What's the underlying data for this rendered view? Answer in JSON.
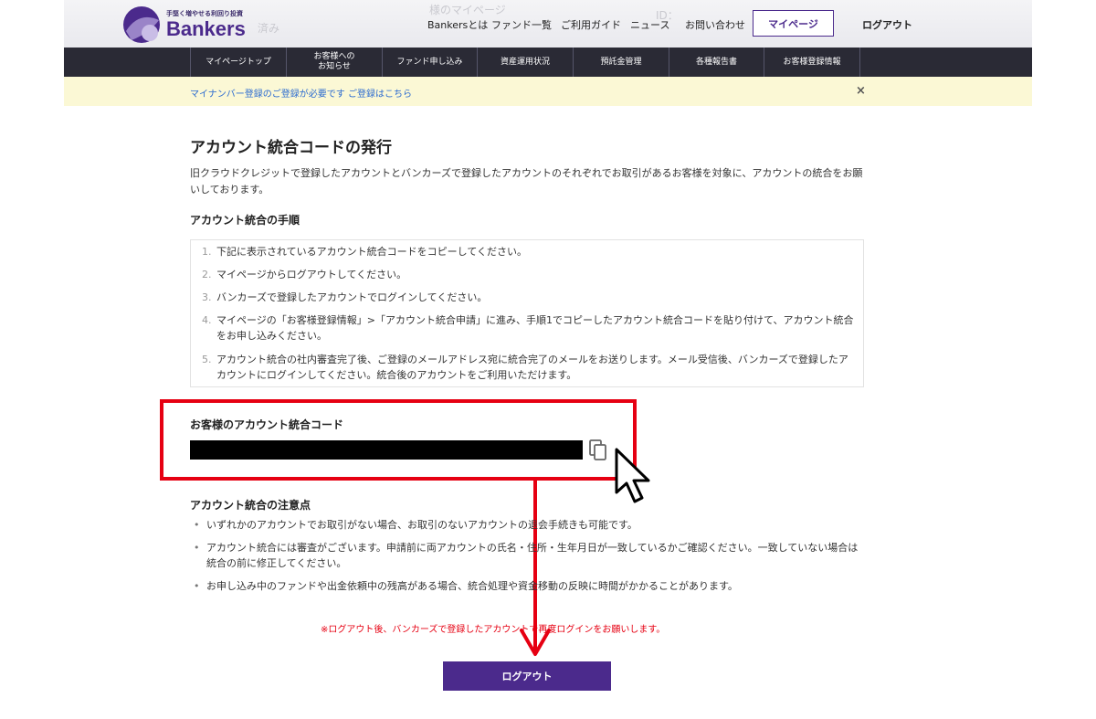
{
  "header": {
    "ghost_texts": [
      "様のマイページ",
      "済み",
      "ID："
    ],
    "logo_tagline": "手堅く増やせる利回り投資",
    "logo_name": "Bankers",
    "nav": [
      "Bankersとは",
      "ファンド一覧",
      "ご利用ガイド",
      "ニュース",
      "お問い合わせ"
    ],
    "mypage_button": "マイページ",
    "logout_link": "ログアウト"
  },
  "subnav": {
    "items": [
      "マイページトップ",
      "お客様への\nお知らせ",
      "ファンド申し込み",
      "資産運用状況",
      "預託金管理",
      "各種報告書",
      "お客様登録情報"
    ]
  },
  "notice": {
    "text": "マイナンバー登録のご登録が必要です ご登録はこちら",
    "close": "×"
  },
  "main": {
    "title": "アカウント統合コードの発行",
    "intro": "旧クラウドクレジットで登録したアカウントとバンカーズで登録したアカウントのそれぞれでお取引があるお客様を対象に、アカウントの統合をお願いしております。",
    "steps_heading": "アカウント統合の手順",
    "steps": [
      {
        "num": "1.",
        "text": "下記に表示されているアカウント統合コードをコピーしてください。"
      },
      {
        "num": "2.",
        "text": "マイページからログアウトしてください。"
      },
      {
        "num": "3.",
        "text": "バンカーズで登録したアカウントでログインしてください。"
      },
      {
        "num": "4.",
        "text": "マイページの「お客様登録情報」>「アカウント統合申請」に進み、手順1でコピーしたアカウント統合コードを貼り付けて、アカウント統合をお申し込みください。"
      },
      {
        "num": "5.",
        "text": "アカウント統合の社内審査完了後、ご登録のメールアドレス宛に統合完了のメールをお送りします。メール受信後、バンカーズで登録したアカウントにログインしてください。統合後のアカウントをご利用いただけます。"
      }
    ],
    "code_heading": "お客様のアカウント統合コード",
    "notes_heading": "アカウント統合の注意点",
    "notes": [
      "いずれかのアカウントでお取引がない場合、お取引のないアカウントの退会手続きも可能です。",
      "アカウント統合には審査がございます。申請前に両アカウントの氏名・住所・生年月日が一致しているかご確認ください。一致していない場合は統合の前に修正してください。",
      "お申し込み中のファンドや出金依頼中の残高がある場合、統合処理や資金移動の反映に時間がかかることがあります。"
    ],
    "red_note": "※ログアウト後、バンカーズで登録したアカウントで再度ログインをお願いします。",
    "logout_button": "ログアウト"
  },
  "colors": {
    "brand": "#4b2a8c",
    "highlight_red": "#e60012",
    "subnav_bg": "#2a2a35",
    "notice_bg": "#fbf8d5"
  },
  "icons": [
    "copy-icon",
    "mouse-cursor-icon",
    "down-arrow-icon",
    "close-icon"
  ]
}
